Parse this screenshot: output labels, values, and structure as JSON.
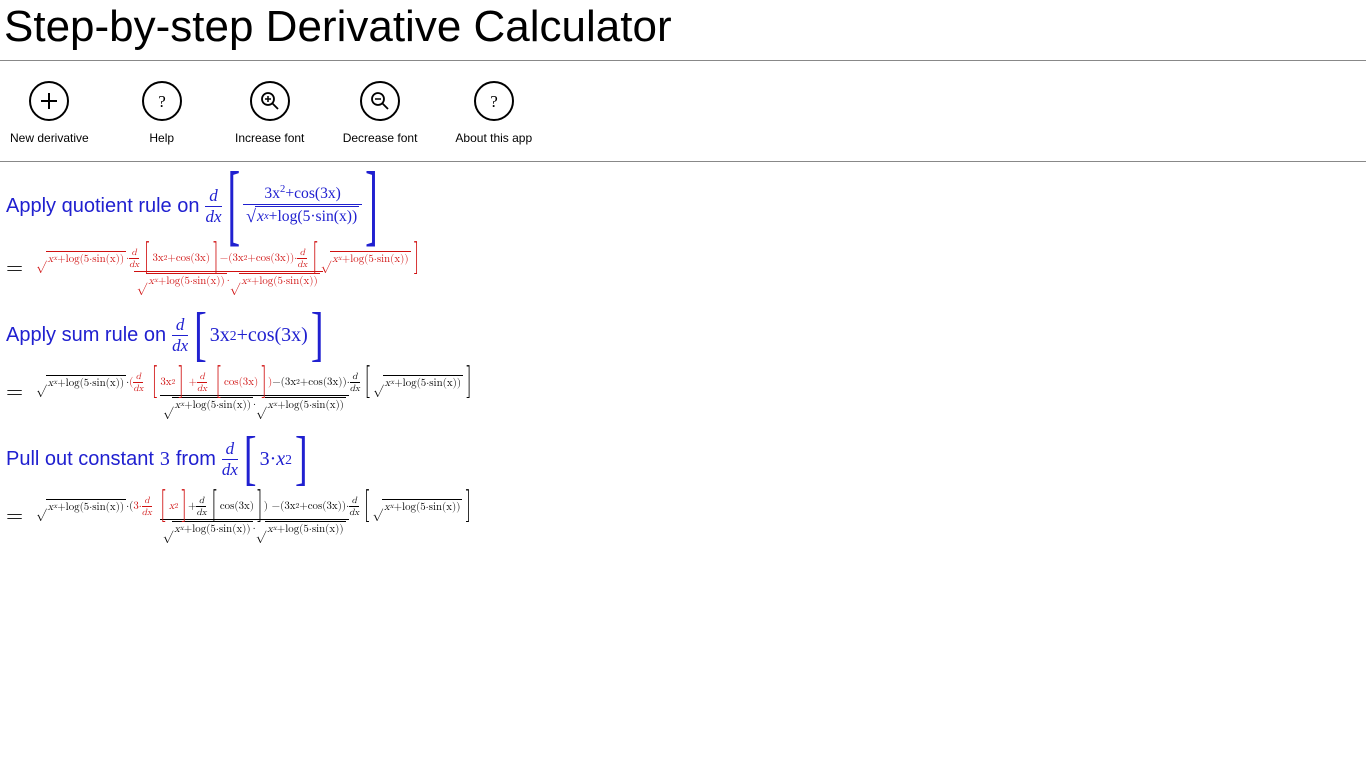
{
  "title": "Step-by-step Derivative Calculator",
  "toolbar": {
    "new": "New derivative",
    "help": "Help",
    "inc": "Increase font",
    "dec": "Decrease font",
    "about": "About this app"
  },
  "steps": {
    "s1_prefix": "Apply quotient rule on",
    "s2_prefix": "Apply sum rule on",
    "s3_prefix": "Pull out constant",
    "s3_const": "3",
    "s3_suffix": "from"
  },
  "expr": {
    "d": "d",
    "dx": "dx",
    "three_x2": "3x",
    "cos3x": "cos(3x)",
    "xx": "x",
    "log5sinx": "log(5·sin(x))",
    "three": "3",
    "x2": "x",
    "threedot": "3·"
  }
}
